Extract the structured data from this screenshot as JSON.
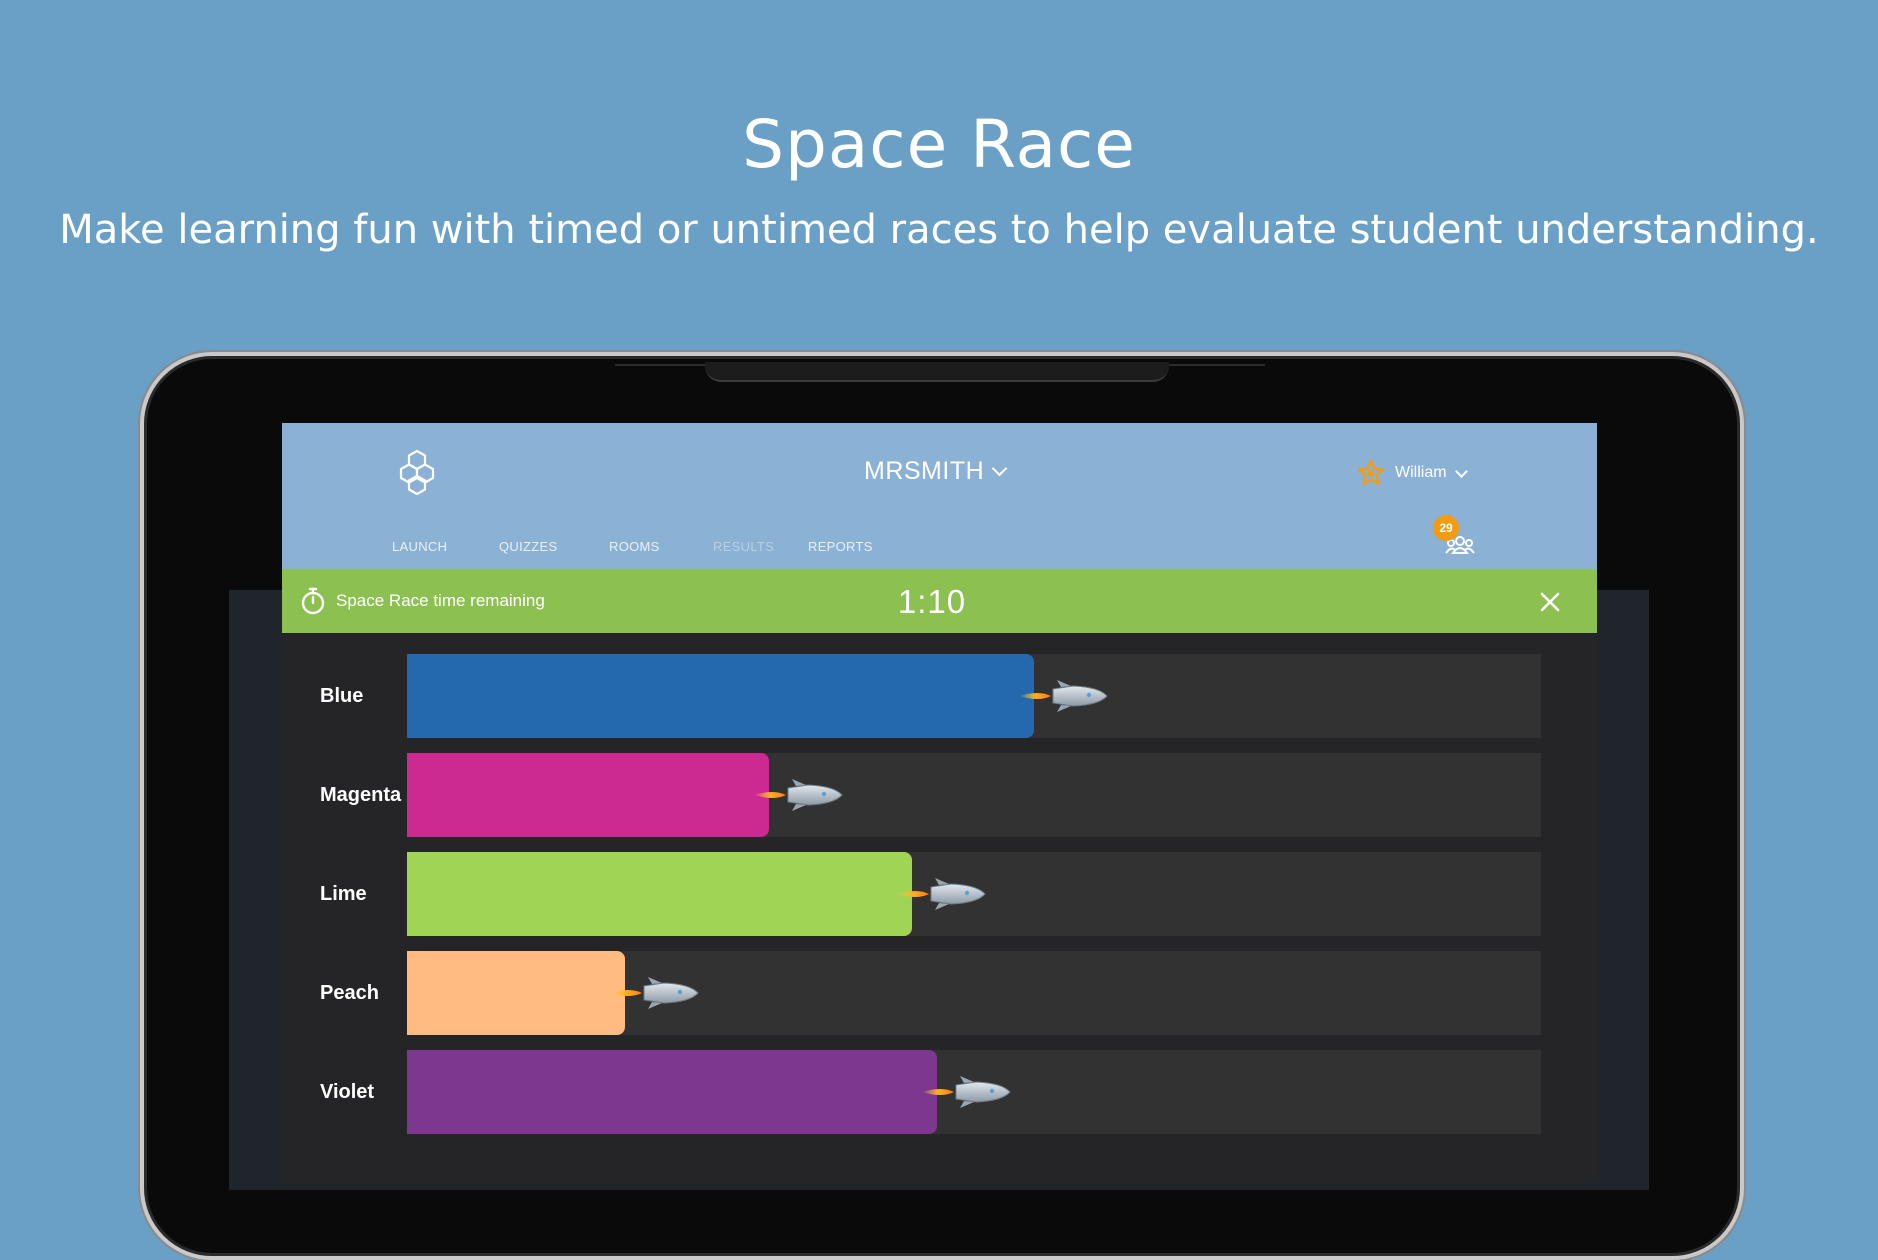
{
  "hero": {
    "title": "Space Race",
    "subtitle": "Make learning fun with timed or untimed races to help evaluate student understanding."
  },
  "header": {
    "room_name": "MRSMITH",
    "user_name": "William",
    "student_count": "29",
    "nav": [
      "LAUNCH",
      "QUIZZES",
      "ROOMS",
      "RESULTS",
      "REPORTS"
    ]
  },
  "timer": {
    "label": "Space Race time remaining",
    "value": "1:10"
  },
  "race": {
    "teams": [
      {
        "name": "Blue",
        "color": "#2468ad",
        "progress": 0.55
      },
      {
        "name": "Magenta",
        "color": "#cc2a91",
        "progress": 0.317
      },
      {
        "name": "Lime",
        "color": "#a0d455",
        "progress": 0.443
      },
      {
        "name": "Peach",
        "color": "#ffbb80",
        "progress": 0.19
      },
      {
        "name": "Violet",
        "color": "#7d378f",
        "progress": 0.465
      }
    ]
  },
  "colors": {
    "page_bg": "#6a9fc6",
    "header_bg": "#8bb1d4",
    "timer_bg": "#8cc152",
    "badge": "#f39c12"
  }
}
